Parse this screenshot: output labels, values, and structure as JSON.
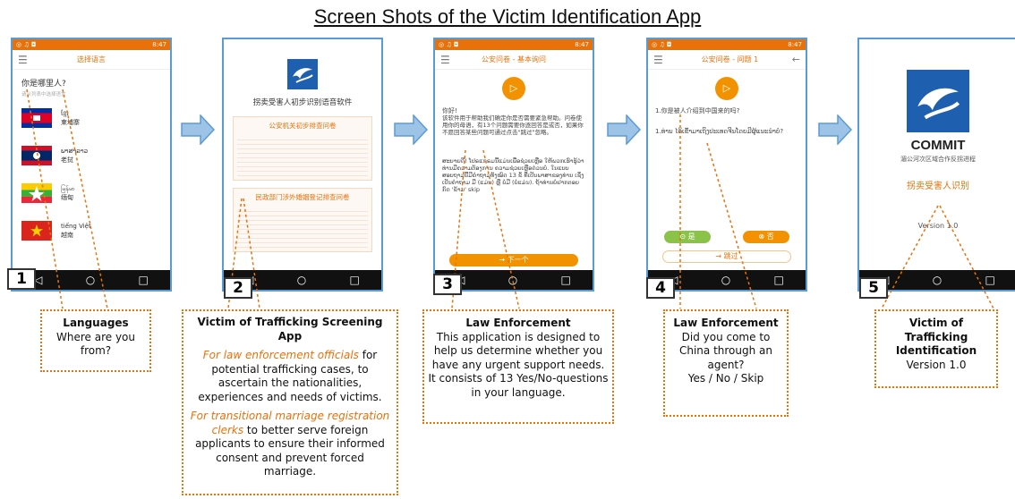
{
  "title": "Screen Shots of the Victim Identification App",
  "status": {
    "time": "8:47"
  },
  "phone1": {
    "appbar_title": "选择语言",
    "question": "你是哪里人?",
    "hint": "请从列表中选择语言",
    "languages": [
      {
        "native": "ខ្មែរ",
        "chinese": "柬埔寨"
      },
      {
        "native": "ພາສາລາວ",
        "chinese": "老挝"
      },
      {
        "native": "မြန်မာ",
        "chinese": "缅甸"
      },
      {
        "native": "tiếng Việt",
        "chinese": "越南"
      }
    ]
  },
  "phone2": {
    "app_name": "拐卖受害人初步识别语音软件",
    "card1_title": "公安机关初步排查问卷",
    "card2_title": "民政部门涉外婚姻登记排查问卷"
  },
  "phone3": {
    "appbar_title": "公安问卷 - 基本询问",
    "greeting": "你好!",
    "body_cn": "该软件用于帮助我们确定你是否需要紧急帮助。问卷使用你的母语，有13个问题需要你逐回答是或否，如果你不愿回答某些问题可通过点击\"跳过\"忽略。",
    "body_lao": "ສະບາຍດີ! ໂປຣແກຣມນີ້ແມ່ນເພື່ອຊ່ວຍເຫຼືອ ໃຫ້ພວກເຮົາຮູ້ວ່າທ່ານມີຄວາມຕ້ອງການ ຄວາມຊ່ວຍເຫຼືອດ່ວນບໍ່. ໃນແບບສອບຖາມນີ້ມີຄຳຖາມທັງໝົດ 13 ຂໍ້ ທີ່ເປັນພາສາຂອງທ່ານ ເຊິ່ງເປັນຄຳຖາມ ມີ (ແມ່ນ) ຫຼື ບໍ່ມີ (ບໍ່ແມ່ນ). ຖ້າທ່ານບໍ່ຢາກຕອບ ກົດ 'ຂ້າມ' skip",
    "next": "→ 下一个"
  },
  "phone4": {
    "appbar_title": "公安问卷 - 问题 1",
    "question_cn": "1.你是被人介绍到中国来的吗?",
    "question_lao": "1.ທ່ານ ໄດ້ເຂົ້າມາເຖິງປະເທດຈີນໂດຍມີຜູ້ແນະນຳບໍ່?",
    "yes": "是",
    "no": "否",
    "skip": "→ 跳过"
  },
  "phone5": {
    "brand": "COMMIT",
    "subtitle": "湄公河次区域合作反拐进程",
    "app_title": "拐卖受害人识别",
    "version": "Version 1.0"
  },
  "steps": [
    "1",
    "2",
    "3",
    "4",
    "5"
  ],
  "callouts": {
    "c1": {
      "title": "Languages",
      "body": "Where are you from?"
    },
    "c2": {
      "title": "Victim of Trafficking Screening App",
      "p1_orange": "For law enforcement officials",
      "p1_rest": " for potential trafficking cases, to ascertain the nationalities, experiences and needs of victims.",
      "p2_orange": "For transitional marriage registration clerks",
      "p2_rest": " to better serve foreign applicants to ensure their informed consent and prevent forced marriage."
    },
    "c3": {
      "title": "Law Enforcement",
      "body": "This application is designed to help us determine whether you have any urgent support needs. It consists of 13 Yes/No-questions  in your language."
    },
    "c4": {
      "title": "Law Enforcement",
      "body": "Did you come to China through an agent?",
      "answers": "Yes / No / Skip"
    },
    "c5": {
      "title": "Victim of Trafficking Identification",
      "body": "Version 1.0"
    }
  },
  "colors": {
    "accent": "#e8710a",
    "frame": "#5b9bd5",
    "arrow": "#5b9bd5"
  }
}
